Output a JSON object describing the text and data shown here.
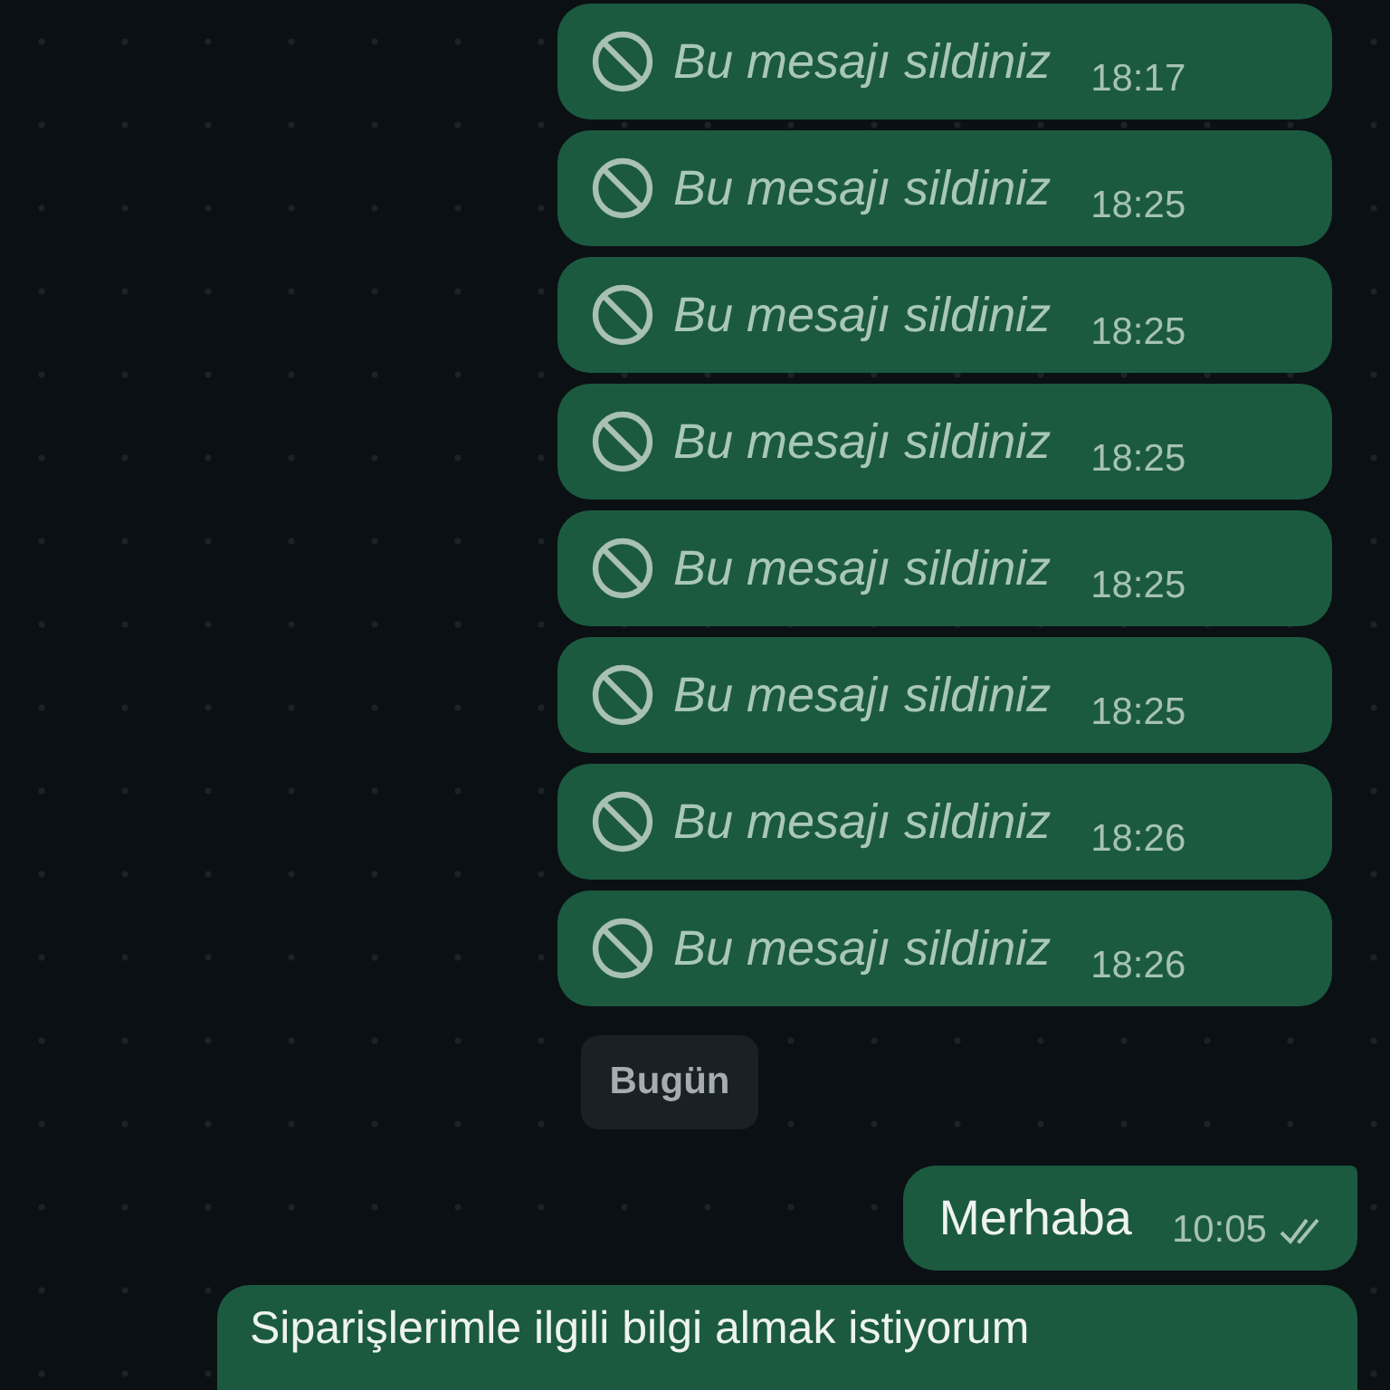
{
  "messages": [
    {
      "kind": "deleted",
      "text": "Bu mesajı sildiniz",
      "time": "18:17"
    },
    {
      "kind": "deleted",
      "text": "Bu mesajı sildiniz",
      "time": "18:25"
    },
    {
      "kind": "deleted",
      "text": "Bu mesajı sildiniz",
      "time": "18:25"
    },
    {
      "kind": "deleted",
      "text": "Bu mesajı sildiniz",
      "time": "18:25"
    },
    {
      "kind": "deleted",
      "text": "Bu mesajı sildiniz",
      "time": "18:25"
    },
    {
      "kind": "deleted",
      "text": "Bu mesajı sildiniz",
      "time": "18:25"
    },
    {
      "kind": "deleted",
      "text": "Bu mesajı sildiniz",
      "time": "18:26"
    },
    {
      "kind": "deleted",
      "text": "Bu mesajı sildiniz",
      "time": "18:26"
    },
    {
      "kind": "date",
      "text": "Bugün"
    },
    {
      "kind": "text",
      "text": "Merhaba",
      "time": "10:05"
    },
    {
      "kind": "text",
      "text": "Siparişlerimle ilgili bilgi almak istiyorum"
    }
  ]
}
